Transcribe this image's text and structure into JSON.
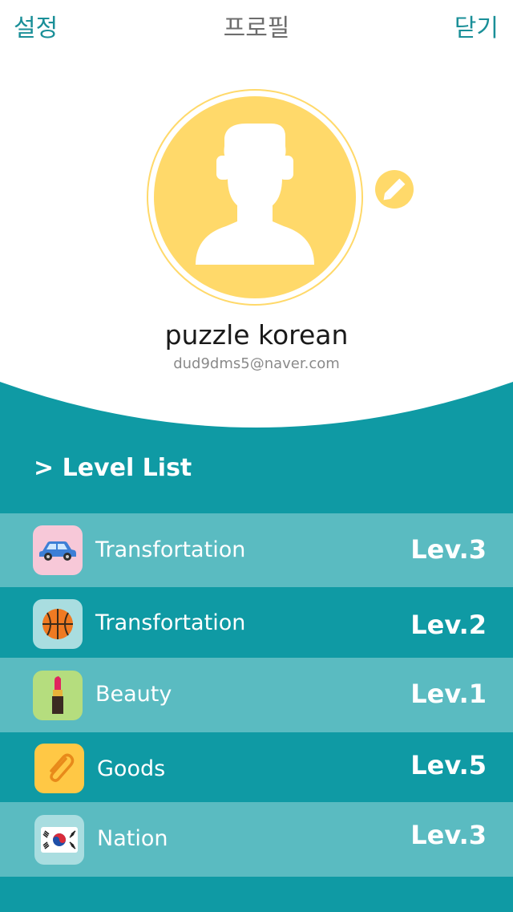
{
  "nav": {
    "left_label": "설정",
    "title": "프로필",
    "right_label": "닫기",
    "accent_color": "#1a8f98"
  },
  "profile": {
    "name": "puzzle korean",
    "email": "dud9dms5@naver.com",
    "avatar_icon": "user-silhouette-icon",
    "edit_icon": "pencil-icon",
    "avatar_color": "#ffd96a"
  },
  "level_list": {
    "title": "> Level List",
    "items": [
      {
        "label": "Transfortation",
        "level": "Lev.3",
        "icon": "car-icon",
        "icon_bg": "#f7c8d8"
      },
      {
        "label": "Transfortation",
        "level": "Lev.2",
        "icon": "basketball-icon",
        "icon_bg": "#a9dde0"
      },
      {
        "label": "Beauty",
        "level": "Lev.1",
        "icon": "lipstick-icon",
        "icon_bg": "#b5dd7e"
      },
      {
        "label": "Goods",
        "level": "Lev.5",
        "icon": "paperclip-icon",
        "icon_bg": "#ffc845"
      },
      {
        "label": "Nation",
        "level": "Lev.3",
        "icon": "korea-flag-icon",
        "icon_bg": "#a9dde0"
      }
    ]
  }
}
